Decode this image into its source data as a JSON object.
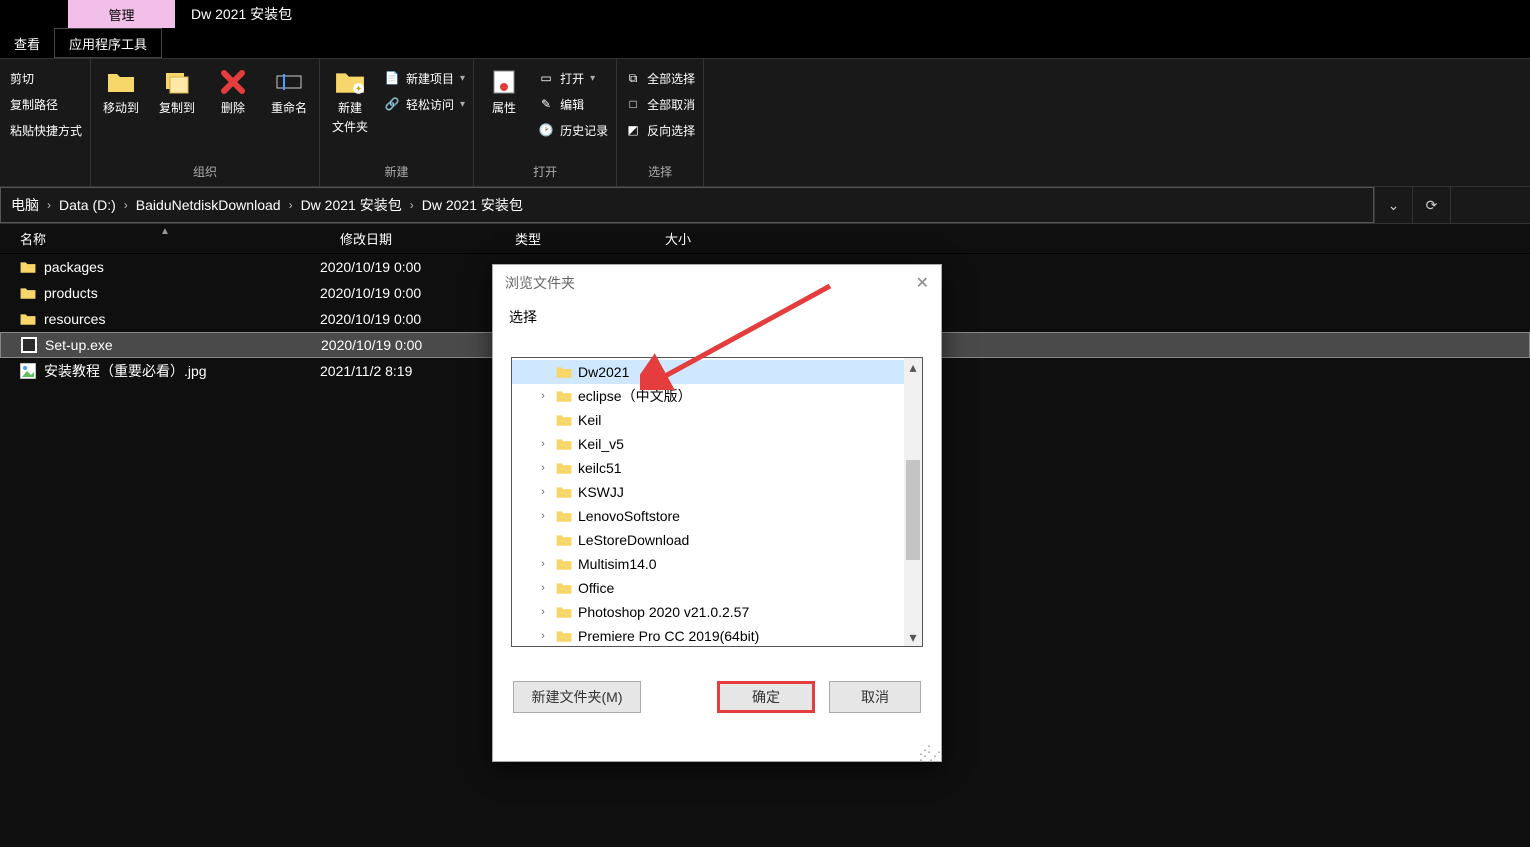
{
  "title": "Dw 2021 安装包",
  "tabs": {
    "view": "查看",
    "manage": "管理",
    "apptools": "应用程序工具"
  },
  "ribbon": {
    "clipboard": {
      "cut": "剪切",
      "copypath": "复制路径",
      "pasteshortcut": "粘贴快捷方式"
    },
    "organize": {
      "moveto": "移动到",
      "copyto": "复制到",
      "del": "删除",
      "rename": "重命名",
      "label": "组织"
    },
    "new": {
      "newfolder_l1": "新建",
      "newfolder_l2": "文件夹",
      "newitem": "新建项目",
      "easyaccess": "轻松访问",
      "label": "新建"
    },
    "open": {
      "props": "属性",
      "open": "打开",
      "edit": "编辑",
      "history": "历史记录",
      "label": "打开"
    },
    "select": {
      "all": "全部选择",
      "none": "全部取消",
      "invert": "反向选择",
      "label": "选择"
    }
  },
  "breadcrumbs": [
    "电脑",
    "Data (D:)",
    "BaiduNetdiskDownload",
    "Dw 2021 安装包",
    "Dw 2021 安装包"
  ],
  "columns": {
    "name": "名称",
    "date": "修改日期",
    "type": "类型",
    "size": "大小"
  },
  "files": [
    {
      "icon": "folder",
      "name": "packages",
      "date": "2020/10/19 0:00"
    },
    {
      "icon": "folder",
      "name": "products",
      "date": "2020/10/19 0:00"
    },
    {
      "icon": "folder",
      "name": "resources",
      "date": "2020/10/19 0:00"
    },
    {
      "icon": "exe",
      "name": "Set-up.exe",
      "date": "2020/10/19 0:00",
      "selected": true
    },
    {
      "icon": "img",
      "name": "安装教程（重要必看）.jpg",
      "date": "2021/11/2 8:19"
    }
  ],
  "dialog": {
    "title": "浏览文件夹",
    "instruction": "选择",
    "tree": [
      {
        "name": "Dw2021",
        "selected": true,
        "expandable": false
      },
      {
        "name": "eclipse（中文版）",
        "expandable": true
      },
      {
        "name": "Keil",
        "expandable": false
      },
      {
        "name": "Keil_v5",
        "expandable": true
      },
      {
        "name": "keilc51",
        "expandable": true
      },
      {
        "name": "KSWJJ",
        "expandable": true
      },
      {
        "name": "LenovoSoftstore",
        "expandable": true
      },
      {
        "name": "LeStoreDownload",
        "expandable": false
      },
      {
        "name": "Multisim14.0",
        "expandable": true
      },
      {
        "name": "Office",
        "expandable": true
      },
      {
        "name": "Photoshop 2020 v21.0.2.57",
        "expandable": true
      },
      {
        "name": "Premiere Pro CC 2019(64bit)",
        "expandable": true
      }
    ],
    "buttons": {
      "newfolder": "新建文件夹(M)",
      "ok": "确定",
      "cancel": "取消"
    }
  }
}
